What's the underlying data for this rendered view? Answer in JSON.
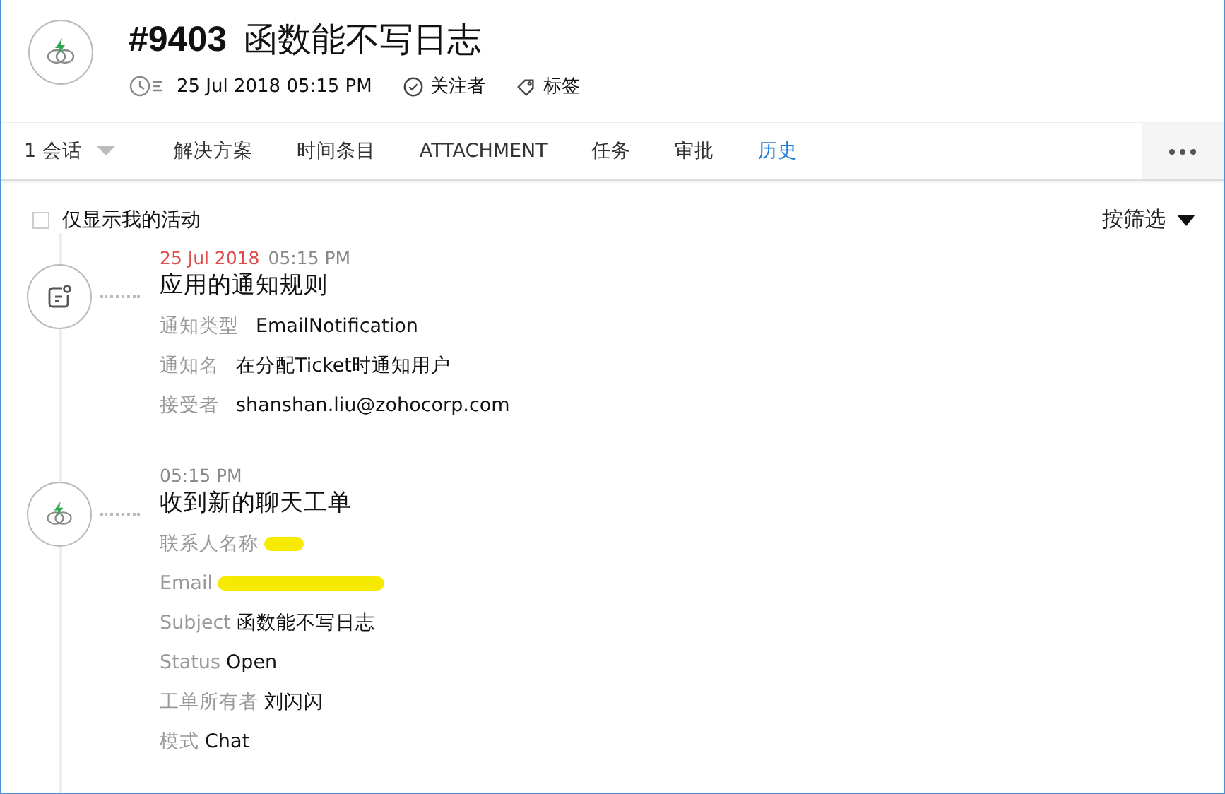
{
  "ticket": {
    "number": "#9403",
    "title": "函数能不写日志",
    "date": "25 Jul 2018 05:15 PM",
    "followers": "关注者",
    "tags": "标签"
  },
  "tabs": [
    {
      "label": "1 会话",
      "selected": false,
      "dropdown": true
    },
    {
      "label": "解决方案",
      "selected": false,
      "dropdown": false
    },
    {
      "label": "时间条目",
      "selected": false,
      "dropdown": false
    },
    {
      "label": "ATTACHMENT",
      "selected": false,
      "dropdown": false
    },
    {
      "label": "任务",
      "selected": false,
      "dropdown": false
    },
    {
      "label": "审批",
      "selected": false,
      "dropdown": false
    },
    {
      "label": "历史",
      "selected": true,
      "dropdown": false
    }
  ],
  "filter": {
    "only_mine": {
      "label": "仅显示我的活动",
      "checked": false
    },
    "sort": "按筛选"
  },
  "events": [
    {
      "kind": "notification",
      "date": "25 Jul 2018",
      "time": "05:15 PM",
      "title": "应用的通知规则",
      "fields": [
        {
          "label": "通知类型",
          "value": "EmailNotification",
          "redacted": false
        },
        {
          "label": "通知名",
          "value": "在分配Ticket时通知用户",
          "redacted": false
        },
        {
          "label": "接受者",
          "value": "shanshan.liu@zohocorp.com",
          "redacted": false
        }
      ]
    },
    {
      "kind": "chat",
      "time": "05:15 PM",
      "title": "收到新的聊天工单",
      "fields": [
        {
          "label": "联系人名称",
          "redacted": true
        },
        {
          "label": "Email",
          "redacted": true
        },
        {
          "label": "Subject",
          "value": "函数能不写日志",
          "redacted": false
        },
        {
          "label": "Status",
          "value": "Open",
          "redacted": false
        },
        {
          "label": "工单所有者",
          "value": "刘闪闪",
          "redacted": false
        },
        {
          "label": "模式",
          "value": "Chat",
          "redacted": false
        }
      ]
    }
  ]
}
